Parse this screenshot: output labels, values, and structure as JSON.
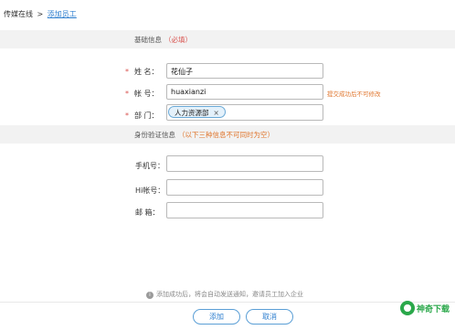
{
  "breadcrumb": {
    "root": "传媒在线",
    "separator": ">",
    "current": "添加员工"
  },
  "section_basic": {
    "title": "基础信息",
    "note": "（必填）"
  },
  "fields_basic": {
    "name": {
      "label": "姓    名：",
      "value": "花仙子"
    },
    "account": {
      "label": "帐    号：",
      "value": "huaxianzi",
      "hint": "提交成功后不可修改"
    },
    "department": {
      "label": "部    门：",
      "tag": "人力资源部",
      "tag_close": "×"
    }
  },
  "required_mark": "*",
  "section_verify": {
    "title": "身份验证信息",
    "note": "（以下三种信息不可同时为空）"
  },
  "fields_verify": {
    "phone": {
      "label": "手机号：",
      "value": ""
    },
    "hi": {
      "label": "Hi帐号：",
      "value": ""
    },
    "email": {
      "label": "邮    箱：",
      "value": ""
    }
  },
  "footer": {
    "tip": "添加成功后，将会自动发送通知，邀请员工加入企业",
    "tip_icon": "i"
  },
  "buttons": {
    "add": "添加",
    "cancel": "取消"
  },
  "watermark": {
    "text": "神奇下载"
  }
}
